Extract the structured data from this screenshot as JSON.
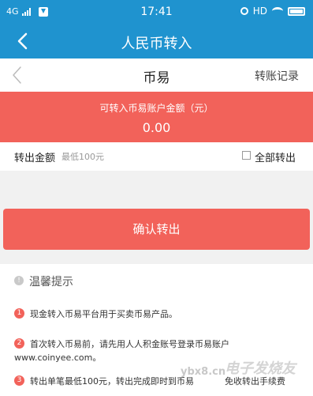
{
  "status_bar": {
    "network": "4G",
    "time": "17:41",
    "hd": "HD",
    "icons": [
      "signal-icon",
      "download-icon",
      "alarm-icon",
      "wifi-icon",
      "battery-icon"
    ]
  },
  "title_bar": {
    "title": "人民币转入"
  },
  "sub_header": {
    "title": "币易",
    "record_link": "转账记录"
  },
  "banner": {
    "label": "可转入币易账户金额（元）",
    "amount": "0.00"
  },
  "amount_row": {
    "label": "转出金额",
    "placeholder": "最低100元",
    "all_label": "全部转出",
    "all_checked": false
  },
  "confirm_button": {
    "label": "确认转出"
  },
  "tips": {
    "icon_glyph": "!",
    "title": "温馨提示",
    "items": [
      {
        "num": "1",
        "lines": [
          "现金转入币易平台用于买卖币易产品。"
        ]
      },
      {
        "num": "2",
        "lines": [
          "首次转入币易前，请先用人人积金账号登录币易账户",
          "www.coinyee.com。"
        ]
      },
      {
        "num": "3",
        "lines": [
          "转出单笔最低100元，转出完成即时到币易",
          "免收转出手续费"
        ]
      }
    ]
  },
  "watermark": {
    "url": "ybx8.cn",
    "brand": "电子发烧友"
  },
  "colors": {
    "primary_blue": "#1f93cf",
    "accent_red": "#f2625a",
    "background": "#f1f1f1"
  }
}
